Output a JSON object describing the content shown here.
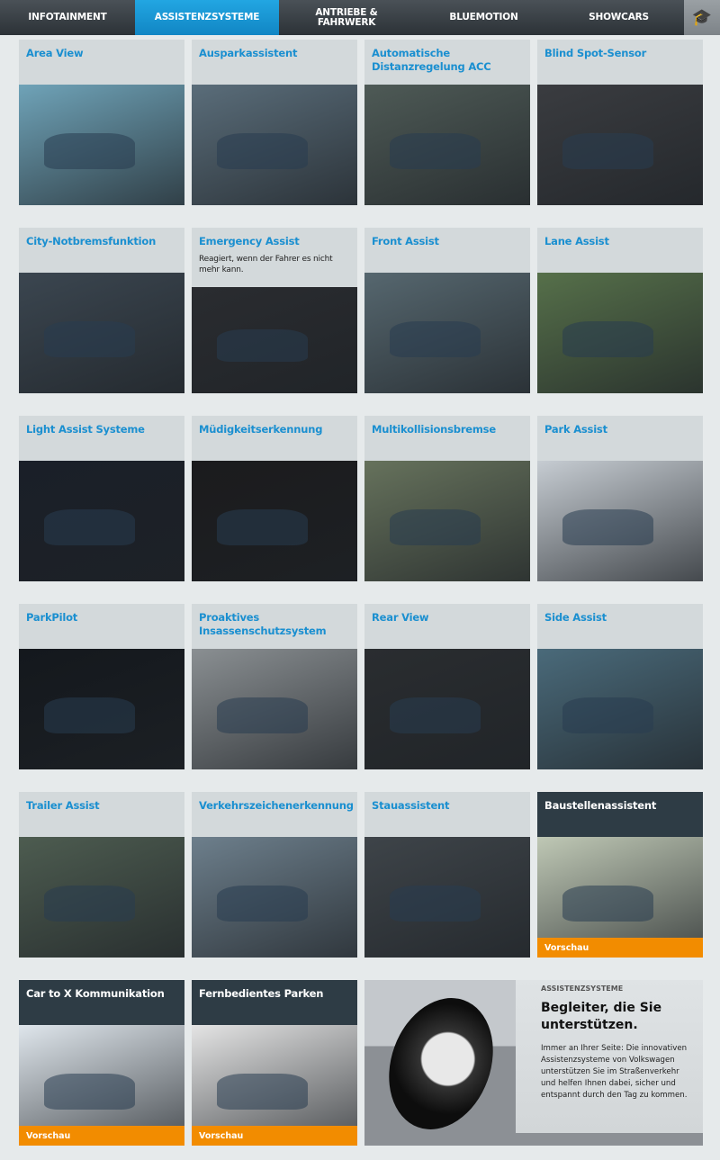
{
  "nav": {
    "items": [
      {
        "label": "INFOTAINMENT",
        "active": false
      },
      {
        "label": "ASSISTENZSYSTEME",
        "active": true
      },
      {
        "label": "ANTRIEBE & FAHRWERK",
        "active": false
      },
      {
        "label": "BLUEMOTION",
        "active": false
      },
      {
        "label": "SHOWCARS",
        "active": false
      }
    ],
    "icon": "graduation-cap-check-icon"
  },
  "colors": {
    "accent": "#1a9ad6",
    "title_blue": "#1a8fd0",
    "preview_orange": "#f28c00",
    "dark_head": "#2e3c45"
  },
  "tiles": [
    {
      "title": "Area View",
      "tone": "#6fa3b8"
    },
    {
      "title": "Ausparkassistent",
      "tone": "#5a6d7a"
    },
    {
      "title": "Automatische Distanzregelung ACC",
      "tone": "#4e5a56"
    },
    {
      "title": "Blind Spot-Sensor",
      "tone": "#3a3c40"
    },
    {
      "title": "City-Notbremsfunktion",
      "tone": "#3b4650"
    },
    {
      "title": "Emergency Assist",
      "subtitle": "Reagiert, wenn der Fahrer es nicht mehr kann.",
      "tone": "#2a2c30"
    },
    {
      "title": "Front Assist",
      "tone": "#56676f"
    },
    {
      "title": "Lane Assist",
      "tone": "#56704a"
    },
    {
      "title": "Light Assist Systeme",
      "tone": "#1a1f28"
    },
    {
      "title": "Müdigkeitserkennung",
      "tone": "#1b1b1d"
    },
    {
      "title": "Multikollisionsbremse",
      "tone": "#66725c"
    },
    {
      "title": "Park Assist",
      "tone": "#c6ccd2"
    },
    {
      "title": "ParkPilot",
      "tone": "#14181d"
    },
    {
      "title": "Proaktives Insassenschutzsystem",
      "tone": "#8a8f92"
    },
    {
      "title": "Rear View",
      "tone": "#2a2d30"
    },
    {
      "title": "Side Assist",
      "tone": "#4a6a7a"
    },
    {
      "title": "Trailer Assist",
      "tone": "#4d5c50"
    },
    {
      "title": "Verkehrszeichenerkennung",
      "tone": "#6d7f8c"
    },
    {
      "title": "Stauassistent",
      "tone": "#3e4449"
    },
    {
      "title": "Baustellenassistent",
      "tone": "#bfc8b5",
      "dark": true,
      "preview": "Vorschau"
    },
    {
      "title": "Car to X Kommunikation",
      "tone": "#dfe6ec",
      "dark": true,
      "preview": "Vorschau"
    },
    {
      "title": "Fernbedientes Parken",
      "tone": "#e4e4e4",
      "dark": true,
      "preview": "Vorschau"
    }
  ],
  "panel": {
    "eyebrow": "ASSISTENZSYSTEME",
    "title": "Begleiter, die Sie unterstützen.",
    "body": "Immer an Ihrer Seite: Die innovativen Assistenzsysteme von Volkswagen unterstützen Sie im Straßenverkehr und helfen Ihnen dabei, sicher und entspannt durch den Tag zu kommen."
  }
}
